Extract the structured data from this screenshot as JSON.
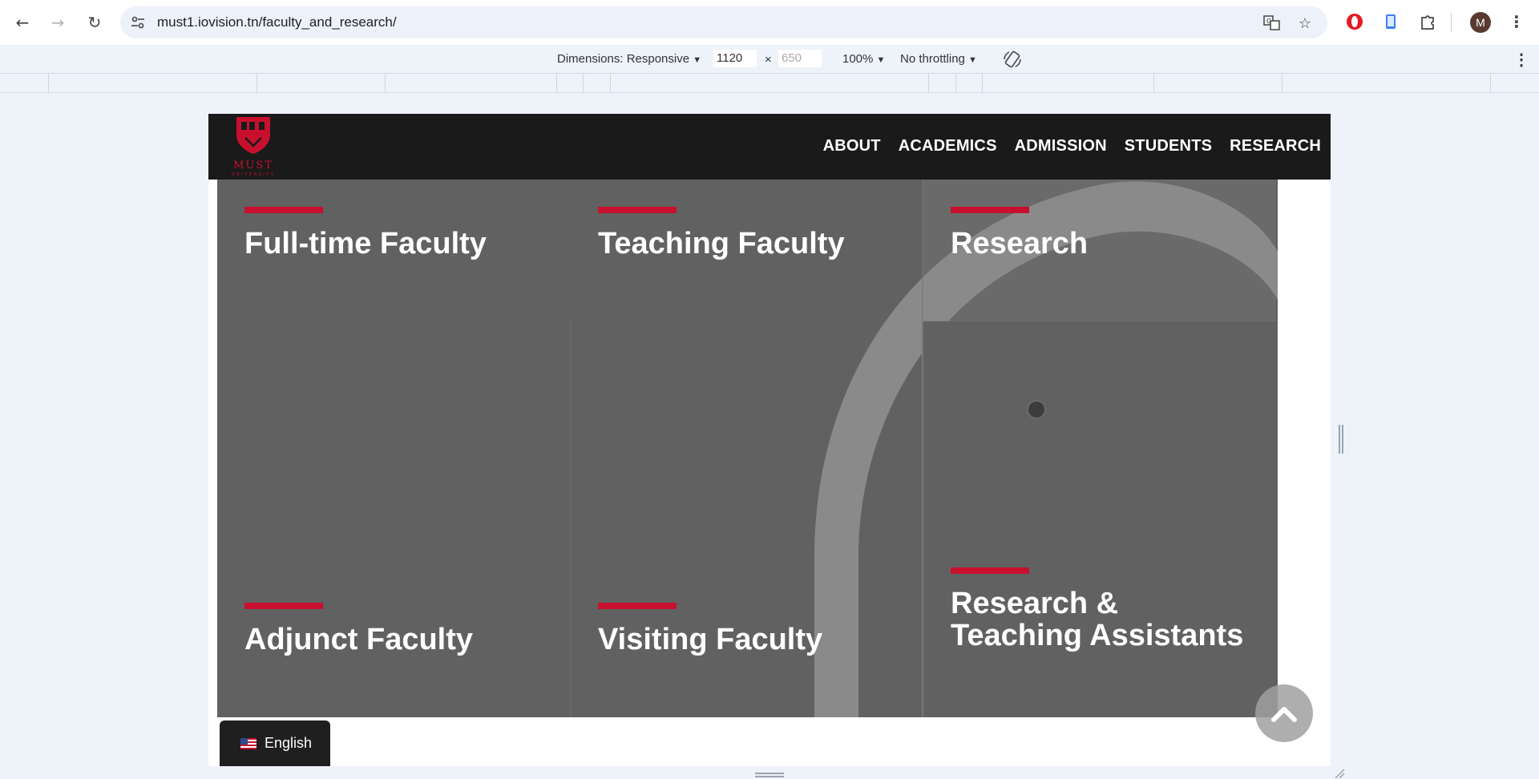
{
  "browser": {
    "url": "must1.iovision.tn/faculty_and_research/",
    "profile_initial": "M",
    "icons": [
      "back-icon",
      "forward-icon",
      "reload-icon",
      "site-settings-icon",
      "translate-icon",
      "star-icon",
      "opera-extension-icon",
      "phone-extension-icon",
      "puzzle-extension-icon",
      "more-icon"
    ]
  },
  "devtools": {
    "dimensions_label": "Dimensions: Responsive",
    "width": "1120",
    "height_placeholder": "650",
    "times": "×",
    "zoom": "100%",
    "throttling": "No throttling",
    "dropdown_caret": "▼"
  },
  "site": {
    "logo_text": "MUST",
    "logo_subtext": "UNIVERSITY",
    "nav": [
      "ABOUT",
      "ACADEMICS",
      "ADMISSION",
      "STUDENTS",
      "RESEARCH"
    ],
    "accent_color": "#c8102e",
    "tiles": [
      {
        "title": "Full-time Faculty"
      },
      {
        "title": "Teaching Faculty"
      },
      {
        "title": "Research"
      },
      {
        "title": "Adjunct Faculty"
      },
      {
        "title": "Visiting Faculty"
      },
      {
        "title_line1": "Research &",
        "title_line2": "Teaching Assistants"
      }
    ],
    "language": "English"
  }
}
